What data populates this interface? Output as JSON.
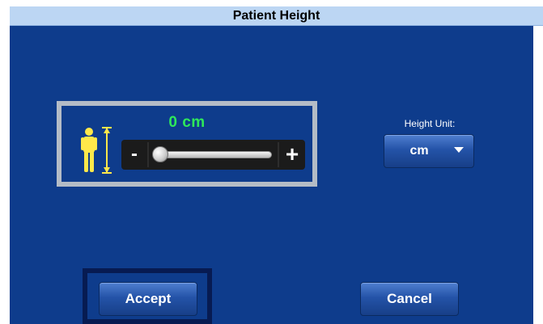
{
  "dialog": {
    "title": "Patient Height"
  },
  "height_control": {
    "value_readout": "0 cm",
    "minus_label": "-",
    "plus_label": "+",
    "slider_fraction": 0,
    "icon": "person-height-icon"
  },
  "unit": {
    "label": "Height Unit:",
    "selected": "cm",
    "dropdown_icon": "caret-down-icon"
  },
  "actions": {
    "accept_label": "Accept",
    "cancel_label": "Cancel"
  },
  "colors": {
    "background": "#0e3c8c",
    "title_bar": "#bcd6f3",
    "readout_green": "#2ee85a",
    "person_icon_yellow": "#ffe84a",
    "panel_border": "#b4bcc6",
    "focus_outline": "#071b52"
  }
}
